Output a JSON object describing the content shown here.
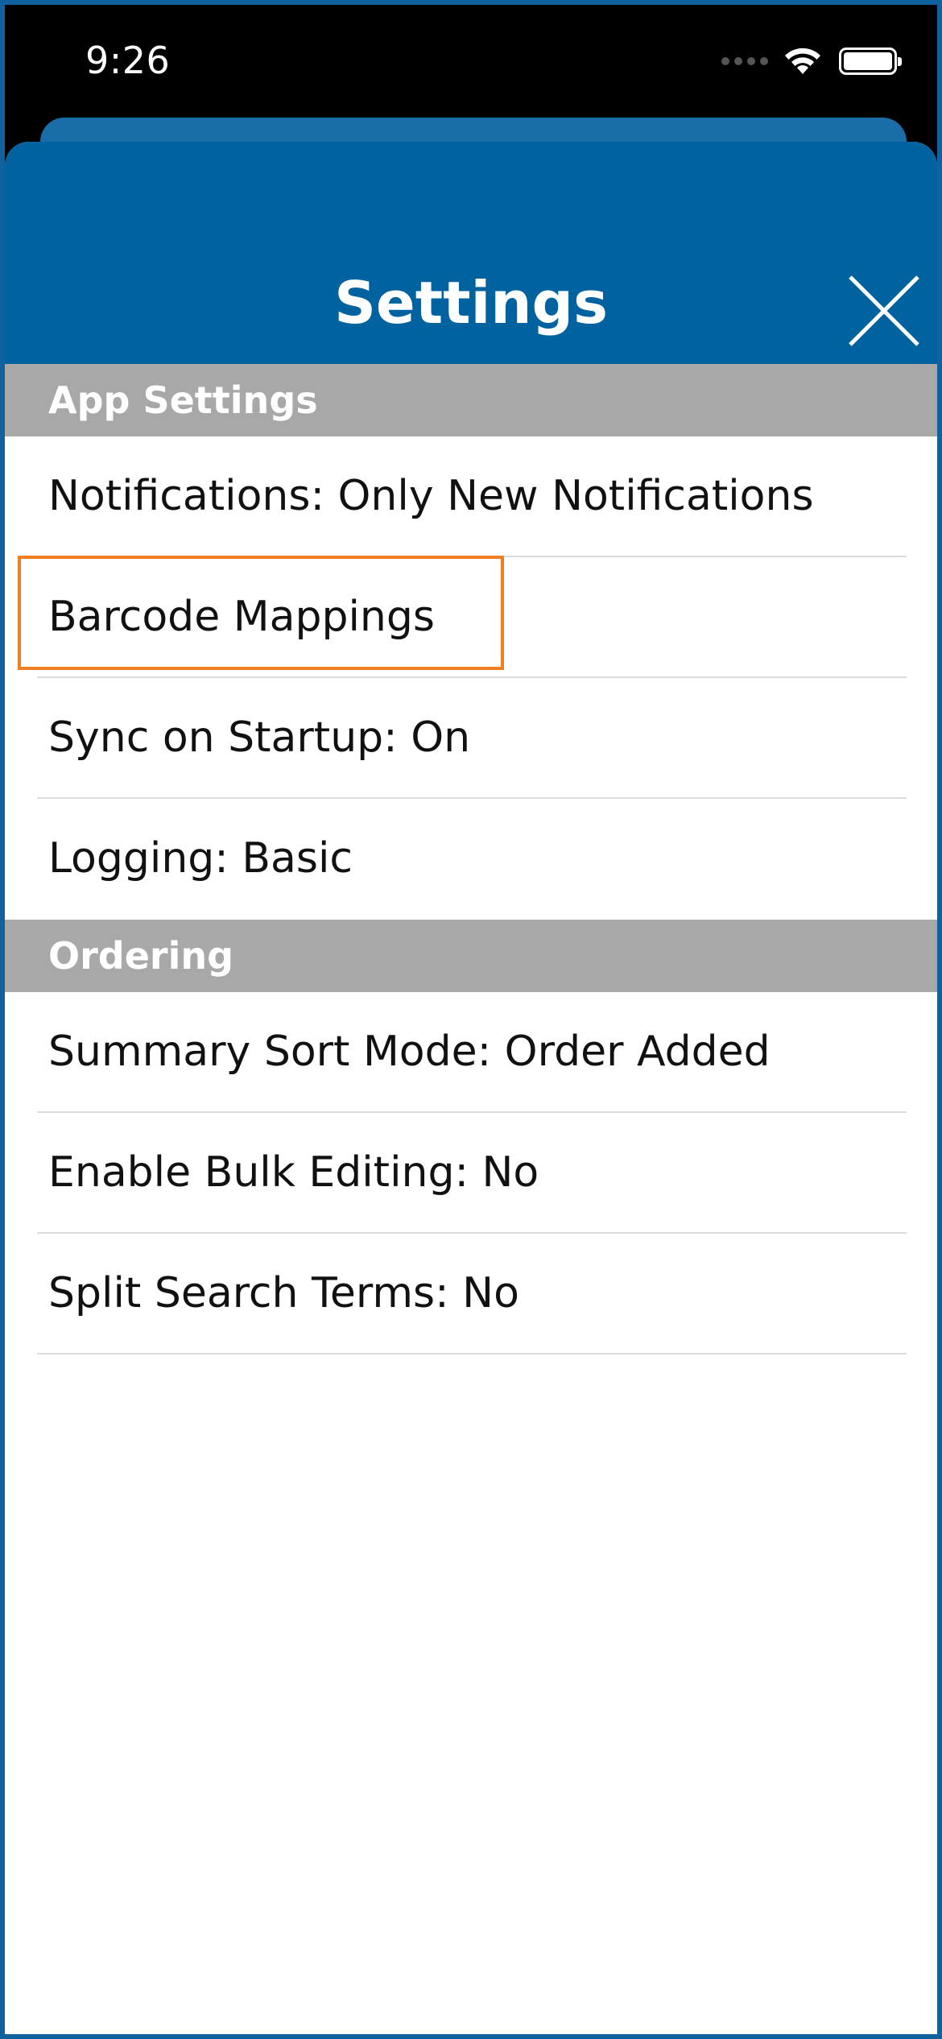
{
  "status_bar": {
    "time": "9:26"
  },
  "header": {
    "title": "Settings",
    "close_icon": "close-x-icon"
  },
  "sections": [
    {
      "title": "App Settings",
      "items": [
        "Notifications: Only New Notifications",
        "Barcode Mappings",
        "Sync on Startup: On",
        "Logging: Basic"
      ]
    },
    {
      "title": "Ordering",
      "items": [
        "Summary Sort Mode: Order Added",
        "Enable Bulk Editing: No",
        "Split Search Terms: No"
      ]
    }
  ],
  "colors": {
    "header_background": "#00629f",
    "section_header_background": "#a8a8a8",
    "highlight_border": "#f07f23"
  }
}
